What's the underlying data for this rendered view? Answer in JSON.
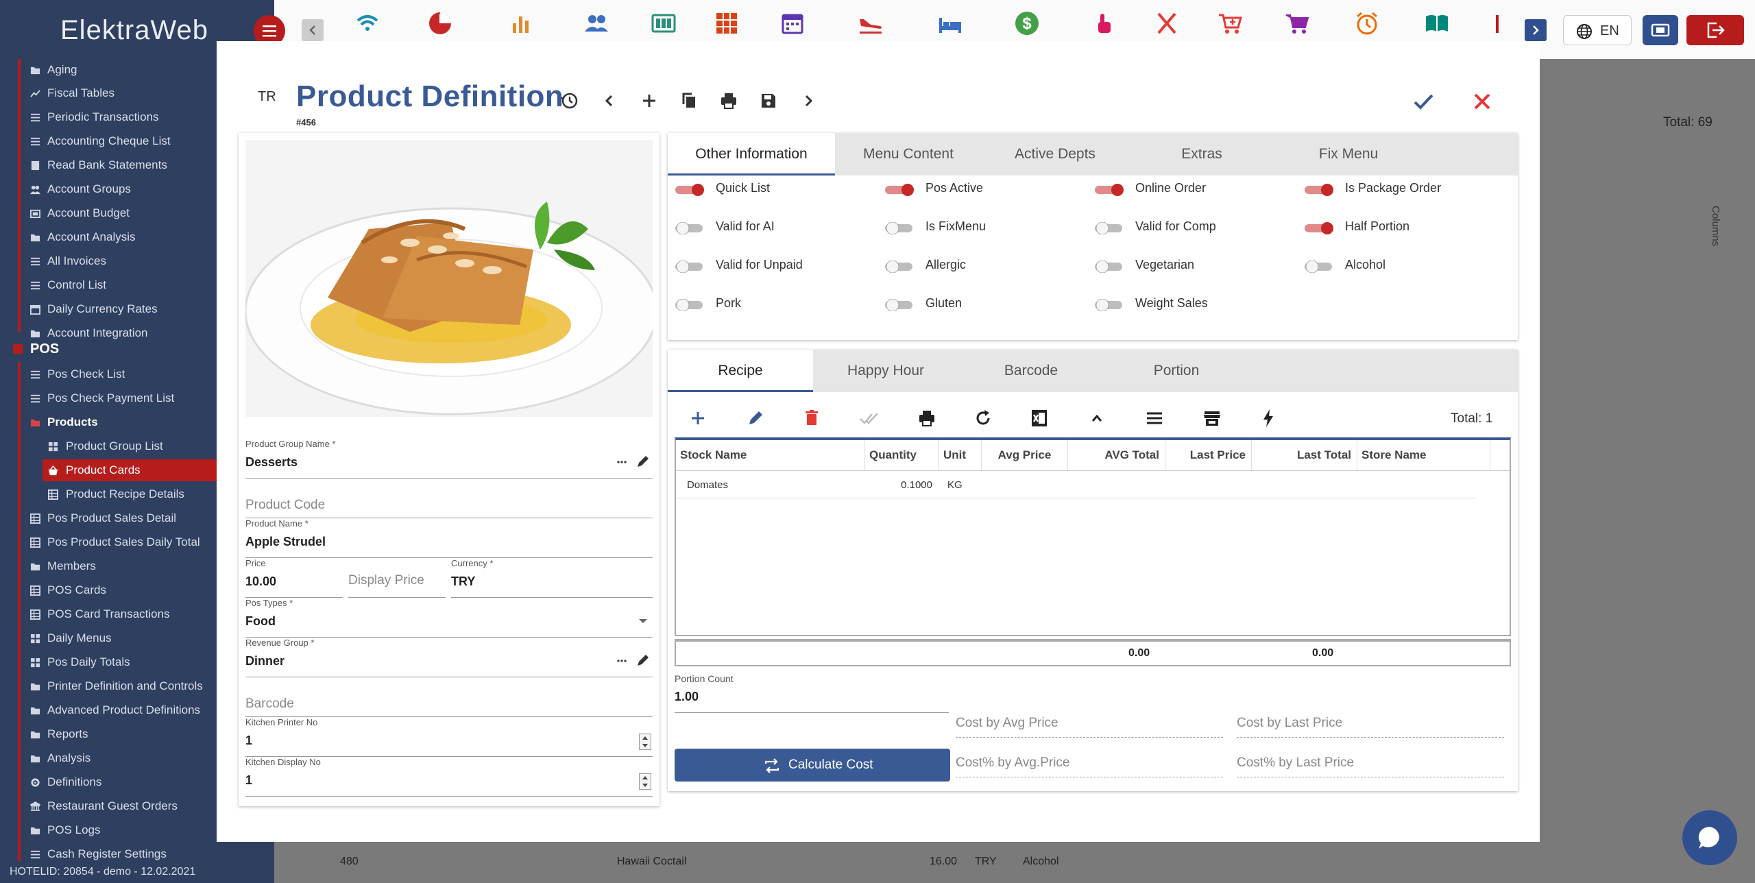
{
  "app": {
    "brand": "ElektraWeb",
    "language": "EN",
    "footer": "HOTELID: 20854 - demo - 12.02.2021"
  },
  "colors": {
    "primary": "#3a5a95",
    "accent": "#b71c1c",
    "sidebar": "#2f3f60"
  },
  "toolbar_icons": [
    "wifi-icon",
    "pie-chart-icon",
    "bar-chart-icon",
    "people-icon",
    "grid-panel-icon",
    "calendar-grid-icon",
    "calendar-icon",
    "plane-landing-icon",
    "bed-icon",
    "dollar-icon",
    "hand-point-icon",
    "cutlery-icon",
    "cart-plus-icon",
    "cart-icon",
    "alarm-icon",
    "book-icon"
  ],
  "sidebar": {
    "items_top": [
      "Aging",
      "Fiscal Tables",
      "Periodic Transactions",
      "Accounting Cheque List",
      "Read Bank Statements",
      "Account Groups",
      "Account Budget",
      "Account Analysis",
      "All Invoices",
      "Control List",
      "Daily Currency Rates",
      "Account Integration"
    ],
    "section": "POS",
    "items_pos": [
      "Pos Check List",
      "Pos Check Payment List"
    ],
    "products": "Products",
    "products_children": [
      "Product Group List",
      "Product Cards",
      "Product Recipe Details"
    ],
    "items_rest": [
      "Pos Product Sales Detail",
      "Pos Product Sales Daily Total",
      "Members",
      "POS Cards",
      "POS Card Transactions",
      "Daily Menus",
      "Pos Daily Totals",
      "Printer Definition and Controls",
      "Advanced Product Definitions",
      "Reports",
      "Analysis",
      "Definitions",
      "Restaurant Guest Orders",
      "POS Logs",
      "Cash Register Settings"
    ]
  },
  "background": {
    "total": "Total: 69",
    "columns": "Columns",
    "row": [
      "480",
      "Hawaii Coctail",
      "16.00",
      "TRY",
      "Alcohol"
    ]
  },
  "modal": {
    "lang": "TR",
    "title": "Product Definition",
    "record_id": "#456",
    "fields": {
      "product_group": {
        "label": "Product Group Name *",
        "value": "Desserts"
      },
      "product_code": {
        "placeholder": "Product Code"
      },
      "product_name": {
        "label": "Product Name *",
        "value": "Apple Strudel"
      },
      "price": {
        "label": "Price",
        "value": "10.00"
      },
      "display_price": {
        "placeholder": "Display Price"
      },
      "currency": {
        "label": "Currency *",
        "value": "TRY"
      },
      "pos_types": {
        "label": "Pos Types *",
        "value": "Food"
      },
      "revenue_group": {
        "label": "Revenue Group *",
        "value": "Dinner"
      },
      "barcode": {
        "placeholder": "Barcode"
      },
      "kitchen_printer": {
        "label": "Kitchen Printer No",
        "value": "1"
      },
      "kitchen_display": {
        "label": "Kitchen Display No",
        "value": "1"
      }
    },
    "info_tabs": [
      "Other Information",
      "Menu Content",
      "Active Depts",
      "Extras",
      "Fix Menu"
    ],
    "toggles": [
      {
        "label": "Quick List",
        "on": true
      },
      {
        "label": "Pos Active",
        "on": true
      },
      {
        "label": "Online Order",
        "on": true
      },
      {
        "label": "Is Package Order",
        "on": true
      },
      {
        "label": "Valid for AI",
        "on": false
      },
      {
        "label": "Is FixMenu",
        "on": false
      },
      {
        "label": "Valid for Comp",
        "on": false
      },
      {
        "label": "Half Portion",
        "on": true
      },
      {
        "label": "Valid for Unpaid",
        "on": false
      },
      {
        "label": "Allergic",
        "on": false
      },
      {
        "label": "Vegetarian",
        "on": false
      },
      {
        "label": "Alcohol",
        "on": false
      },
      {
        "label": "Pork",
        "on": false
      },
      {
        "label": "Gluten",
        "on": false
      },
      {
        "label": "Weight Sales",
        "on": false
      }
    ],
    "recipe_tabs": [
      "Recipe",
      "Happy Hour",
      "Barcode",
      "Portion"
    ],
    "recipe_total": "Total: 1",
    "grid": {
      "columns": [
        "Stock Name",
        "Quantity",
        "Unit",
        "Avg Price",
        "AVG Total",
        "Last Price",
        "Last Total",
        "Store Name"
      ],
      "rows": [
        [
          "Domates",
          "0.1000",
          "KG",
          "",
          "",
          "",
          "",
          ""
        ]
      ],
      "footer": {
        "avg_total": "0.00",
        "last_total": "0.00"
      }
    },
    "portion": {
      "label": "Portion Count",
      "value": "1.00"
    },
    "costs": [
      "Cost by Avg Price",
      "Cost by Last Price",
      "Cost% by Avg.Price",
      "Cost% by Last Price"
    ],
    "calc_button": "Calculate Cost"
  }
}
